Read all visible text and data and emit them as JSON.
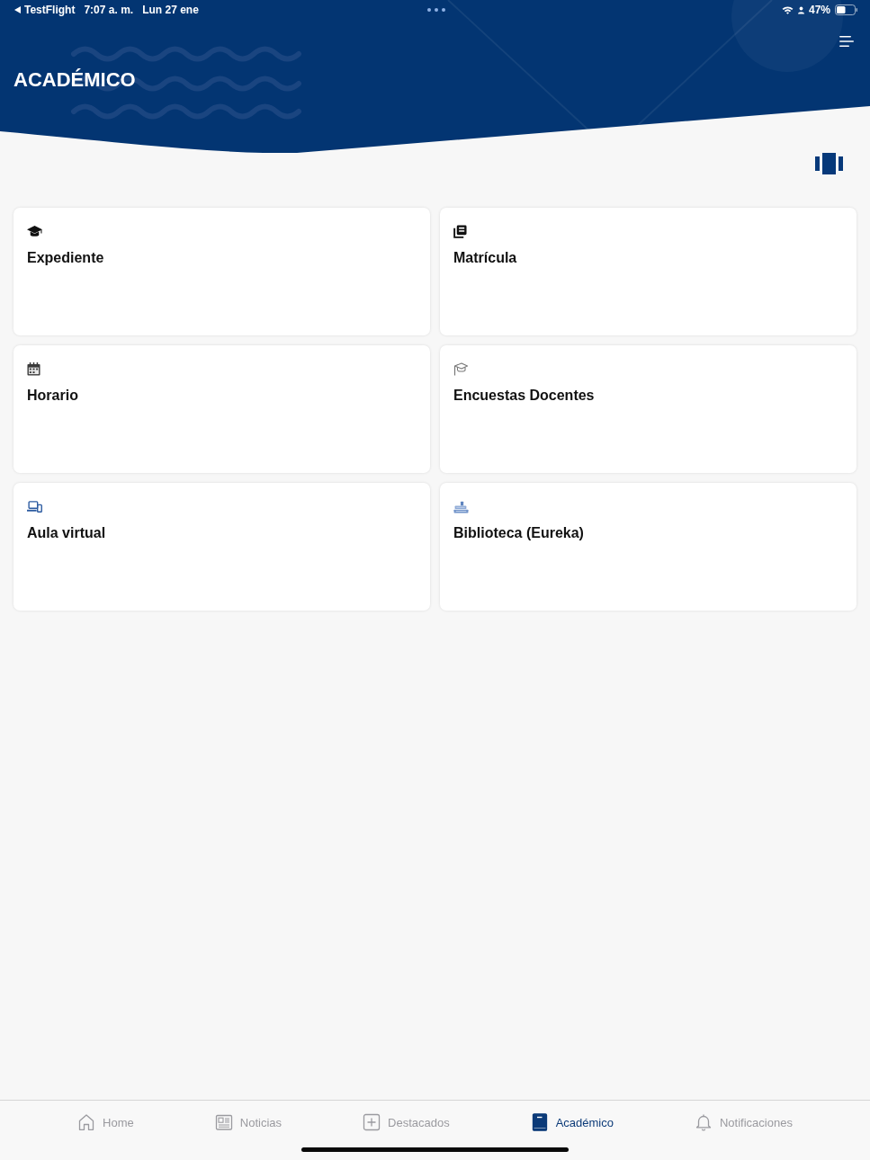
{
  "status_bar": {
    "back_label": "TestFlight",
    "time": "7:07 a. m.",
    "date": "Lun 27 ene",
    "battery": "47%"
  },
  "header": {
    "title": "ACADÉMICO"
  },
  "cards": [
    {
      "kind": "cap",
      "label": "Expediente"
    },
    {
      "kind": "books",
      "label": "Matrícula"
    },
    {
      "kind": "calendar",
      "label": "Horario"
    },
    {
      "kind": "cap-outline",
      "label": "Encuestas Docentes"
    },
    {
      "kind": "devices",
      "label": "Aula virtual"
    },
    {
      "kind": "library",
      "label": "Biblioteca (Eureka)"
    }
  ],
  "tab_bar": {
    "tabs": [
      {
        "kind": "home",
        "label": "Home",
        "selected": false
      },
      {
        "kind": "news",
        "label": "Noticias",
        "selected": false
      },
      {
        "kind": "plus",
        "label": "Destacados",
        "selected": false
      },
      {
        "kind": "book",
        "label": "Académico",
        "selected": true
      },
      {
        "kind": "bell",
        "label": "Notificaciones",
        "selected": false
      }
    ]
  }
}
